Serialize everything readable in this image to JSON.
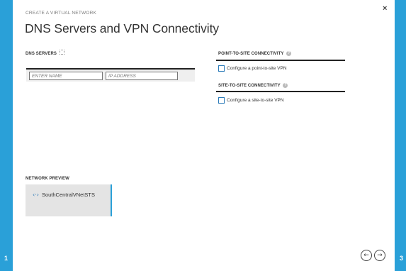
{
  "wizard": {
    "eyebrow": "CREATE A VIRTUAL NETWORK",
    "title": "DNS Servers and VPN Connectivity",
    "close_glyph": "×",
    "step_current": "1",
    "step_total": "3"
  },
  "dns": {
    "label": "DNS SERVERS",
    "name_placeholder": "ENTER NAME",
    "ip_placeholder": "IP ADDRESS"
  },
  "point_to_site": {
    "label": "POINT-TO-SITE CONNECTIVITY",
    "checkbox_label": "Configure a point-to-site VPN",
    "checked": false
  },
  "site_to_site": {
    "label": "SITE-TO-SITE CONNECTIVITY",
    "checkbox_label": "Configure a site-to-site VPN",
    "checked": false
  },
  "preview": {
    "label": "NETWORK PREVIEW",
    "icon": "virtual-network-icon",
    "icon_glyph": "‹·›",
    "network_name": "SouthCentralVNetSTS"
  },
  "nav": {
    "back_glyph": "←",
    "next_glyph": "→"
  },
  "colors": {
    "accent": "#2aa0d8",
    "checkbox_border": "#2a7ab8"
  }
}
